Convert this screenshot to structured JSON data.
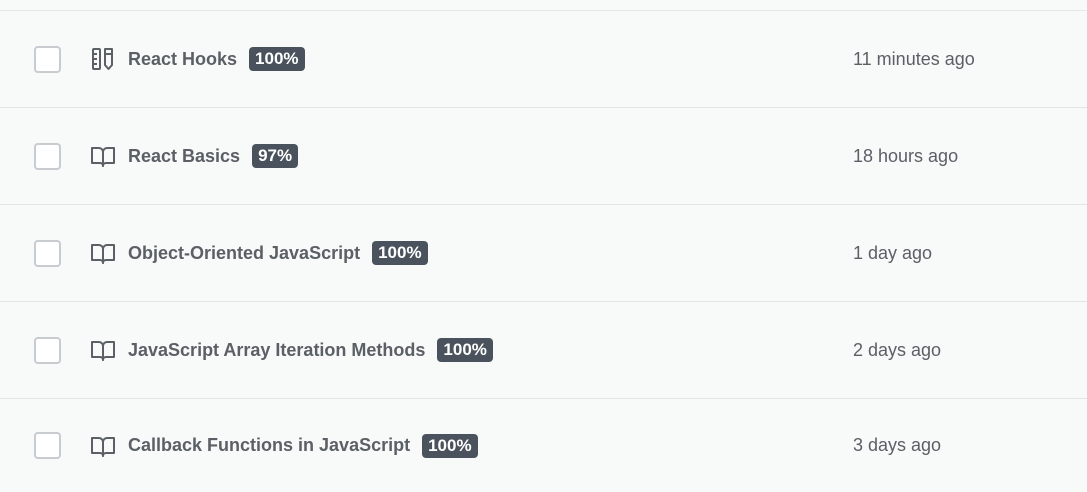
{
  "items": [
    {
      "icon": "workshop-icon",
      "title": "React Hooks",
      "progress": "100%",
      "time": "11 minutes ago"
    },
    {
      "icon": "book-icon",
      "title": "React Basics",
      "progress": "97%",
      "time": "18 hours ago"
    },
    {
      "icon": "book-icon",
      "title": "Object-Oriented JavaScript",
      "progress": "100%",
      "time": "1 day ago"
    },
    {
      "icon": "book-icon",
      "title": "JavaScript Array Iteration Methods",
      "progress": "100%",
      "time": "2 days ago"
    },
    {
      "icon": "book-icon",
      "title": "Callback Functions in JavaScript",
      "progress": "100%",
      "time": "3 days ago"
    }
  ],
  "colors": {
    "background": "#f8f9f9",
    "text": "#5b6066",
    "badge_bg": "#4a535d",
    "badge_text": "#ffffff",
    "divider": "#e2e4e6"
  }
}
